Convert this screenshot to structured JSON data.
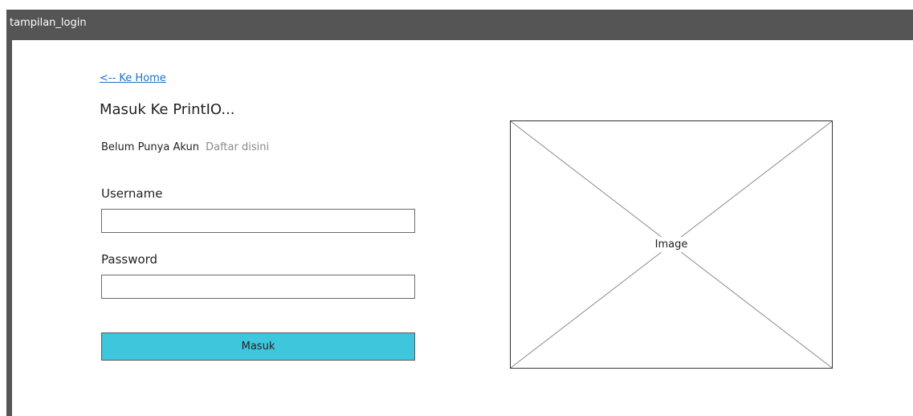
{
  "window": {
    "title": "tampilan_login"
  },
  "nav": {
    "back_link": "<-- Ke Home"
  },
  "form": {
    "heading": "Masuk Ke PrintIO...",
    "signup_prompt": "Belum Punya Akun",
    "signup_link": "Daftar disini",
    "username_label": "Username",
    "username_value": "",
    "password_label": "Password",
    "password_value": "",
    "submit_label": "Masuk"
  },
  "image_placeholder": {
    "label": "Image"
  },
  "colors": {
    "titlebar": "#555555",
    "button": "#3ec6dc",
    "link": "#1a73c7"
  }
}
